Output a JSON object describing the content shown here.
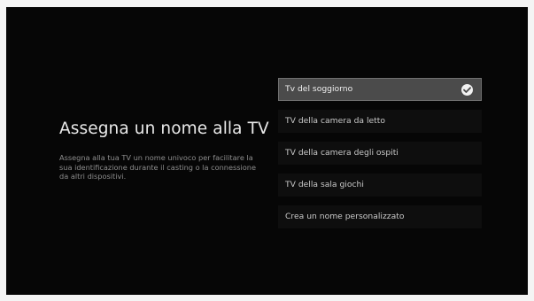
{
  "page": {
    "title": "Assegna un nome alla TV",
    "description": "Assegna alla tua TV un nome univoco per facilitare la sua identificazione durante il casting o la connessione da altri dispositivi."
  },
  "options": [
    {
      "label": "Tv del soggiorno",
      "selected": true
    },
    {
      "label": "TV della camera da letto",
      "selected": false
    },
    {
      "label": "TV della camera degli ospiti",
      "selected": false
    },
    {
      "label": "TV della sala giochi",
      "selected": false
    },
    {
      "label": "Crea un nome personalizzato",
      "selected": false
    }
  ],
  "icons": {
    "selected_indicator": "check-circle-icon"
  },
  "colors": {
    "background": "#060606",
    "selected_item": "#4b4b4b",
    "unselected_item": "#0e0e0e"
  }
}
